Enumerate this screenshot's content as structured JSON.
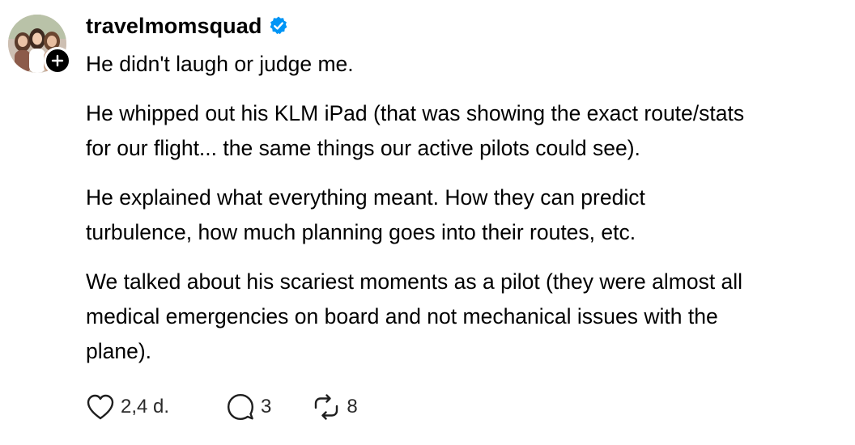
{
  "post": {
    "username": "travelmomsquad",
    "verified": true,
    "paragraphs": [
      [
        "He didn't laugh or judge me."
      ],
      [
        "He whipped out his KLM iPad (that was showing the exact route/stats",
        "for our flight... the same things our active pilots could see)."
      ],
      [
        "He explained what everything meant. How they can predict",
        "turbulence, how much planning goes into their routes, etc."
      ],
      [
        "We talked about his scariest moments as a pilot (they were almost all",
        "medical emergencies on board and not mechanical issues with the",
        "plane)."
      ]
    ],
    "actions": {
      "likes": "2,4 d.",
      "replies": "3",
      "reposts": "8"
    }
  },
  "colors": {
    "verified_badge": "#0095f6",
    "text": "#000000",
    "follow_badge": "#000000"
  },
  "icons": {
    "verified": "verified-check-icon",
    "follow": "plus-icon",
    "like": "heart-icon",
    "reply": "speech-bubble-icon",
    "repost": "repost-arrows-icon"
  }
}
